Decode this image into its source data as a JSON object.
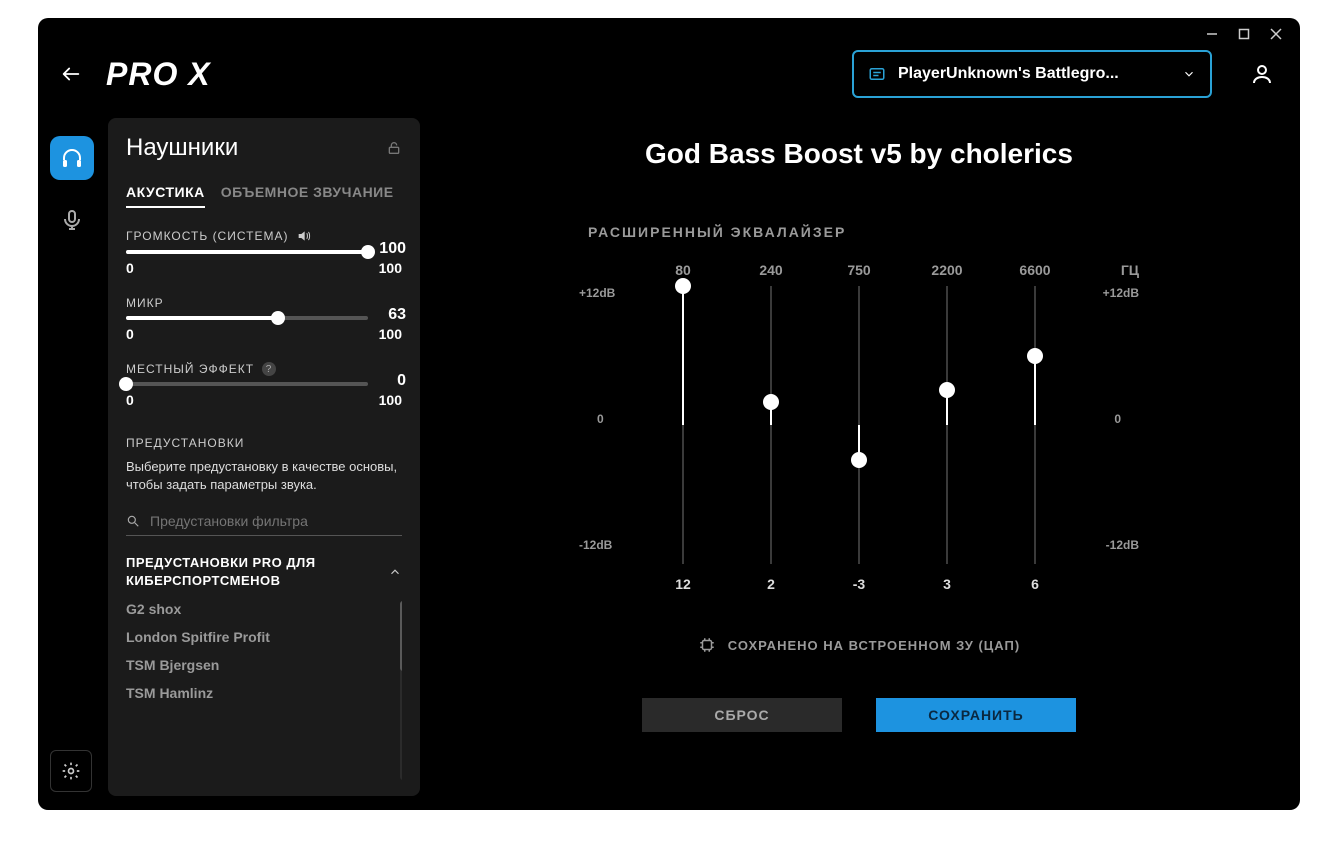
{
  "brand": "PRO X",
  "profile_selector": "PlayerUnknown's Battlegro...",
  "panel": {
    "title": "Наушники",
    "tabs": {
      "acoustic": "АКУСТИКА",
      "surround": "ОБЪЕМНОЕ ЗВУЧАНИЕ"
    },
    "sliders": {
      "volume": {
        "label": "ГРОМКОСТЬ (СИСТЕМА)",
        "value": 100,
        "min": "0",
        "max": "100"
      },
      "mic": {
        "label": "МИКР",
        "value": 63,
        "min": "0",
        "max": "100"
      },
      "sidetone": {
        "label": "МЕСТНЫЙ ЭФФЕКТ",
        "value": 0,
        "min": "0",
        "max": "100"
      }
    },
    "presets": {
      "label": "ПРЕДУСТАНОВКИ",
      "hint": "Выберите предустановку в качестве основы, чтобы задать параметры звука.",
      "search_placeholder": "Предустановки фильтра",
      "group_title": "ПРЕДУСТАНОВКИ PRO ДЛЯ КИБЕРСПОРТСМЕНОВ",
      "items": [
        "G2 shox",
        "London Spitfire Profit",
        "TSM Bjergsen",
        "TSM Hamlinz"
      ]
    }
  },
  "main": {
    "title": "God Bass Boost v5 by cholerics",
    "eq_label": "РАСШИРЕННЫЙ ЭКВАЛАЙЗЕР",
    "hz_label": "ГЦ",
    "db_top": "+12dB",
    "db_mid": "0",
    "db_bot": "-12dB",
    "stored": "СОХРАНЕНО НА ВСТРОЕННОМ ЗУ (ЦАП)",
    "reset": "СБРОС",
    "save": "СОХРАНИТЬ"
  },
  "chart_data": {
    "type": "bar",
    "title": "РАСШИРЕННЫЙ ЭКВАЛАЙЗЕР",
    "xlabel": "ГЦ",
    "ylabel": "dB",
    "ylim": [
      -12,
      12
    ],
    "categories": [
      "80",
      "240",
      "750",
      "2200",
      "6600"
    ],
    "values": [
      12,
      2,
      -3,
      3,
      6
    ]
  }
}
